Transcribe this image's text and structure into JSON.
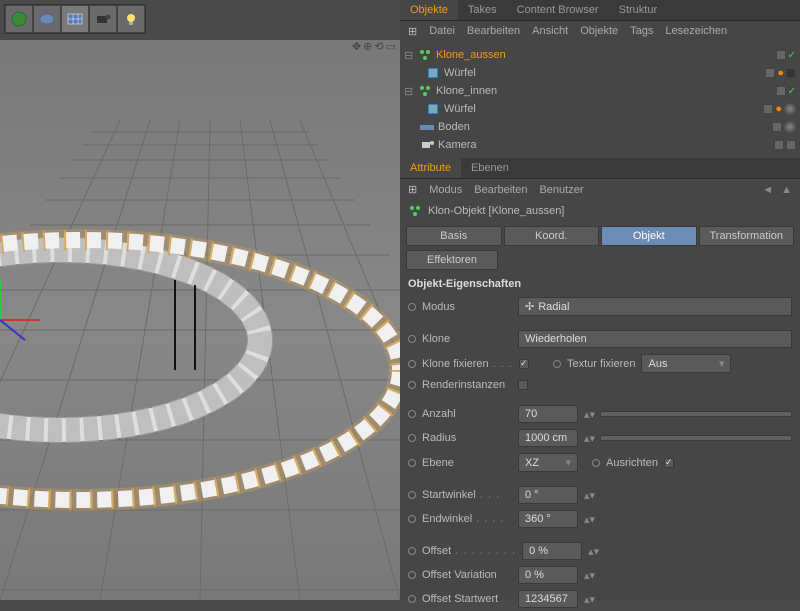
{
  "toolbar": {
    "icons": [
      "sphere",
      "blob",
      "grid",
      "camera",
      "light"
    ]
  },
  "viewport": {
    "axis_center": true
  },
  "tabs_top": {
    "objekte": "Objekte",
    "takes": "Takes",
    "content": "Content Browser",
    "struktur": "Struktur"
  },
  "obj_menu": {
    "datei": "Datei",
    "bearbeiten": "Bearbeiten",
    "ansicht": "Ansicht",
    "objekte": "Objekte",
    "tags": "Tags",
    "lesezeichen": "Lesezeichen"
  },
  "tree": {
    "items": [
      {
        "label": "Klone_aussen",
        "selected": true,
        "icon": "cloner"
      },
      {
        "label": "Würfel",
        "indent": 1,
        "icon": "cube"
      },
      {
        "label": "Klone_innen",
        "icon": "cloner"
      },
      {
        "label": "Würfel",
        "indent": 1,
        "icon": "cube"
      },
      {
        "label": "Boden",
        "icon": "floor"
      },
      {
        "label": "Kamera",
        "icon": "camera"
      }
    ]
  },
  "tabs_attr": {
    "attribute": "Attribute",
    "ebenen": "Ebenen"
  },
  "attr_menu": {
    "modus": "Modus",
    "bearbeiten": "Bearbeiten",
    "benutzer": "Benutzer"
  },
  "obj_title": "Klon-Objekt [Klone_aussen]",
  "attr_tabs": {
    "basis": "Basis",
    "koord": "Koord.",
    "objekt": "Objekt",
    "transformation": "Transformation",
    "effektoren": "Effektoren"
  },
  "section": "Objekt-Eigenschaften",
  "props": {
    "modus_label": "Modus",
    "modus_value": "Radial",
    "klone_label": "Klone",
    "klone_value": "Wiederholen",
    "klone_fix_label": "Klone fixieren",
    "textur_fix_label": "Textur fixieren",
    "textur_fix_value": "Aus",
    "renderinst_label": "Renderinstanzen",
    "anzahl_label": "Anzahl",
    "anzahl_value": "70",
    "radius_label": "Radius",
    "radius_value": "1000 cm",
    "ebene_label": "Ebene",
    "ebene_value": "XZ",
    "ausrichten_label": "Ausrichten",
    "startwinkel_label": "Startwinkel",
    "startwinkel_value": "0 °",
    "endwinkel_label": "Endwinkel",
    "endwinkel_value": "360 °",
    "offset_label": "Offset",
    "offset_value": "0 %",
    "offset_var_label": "Offset Variation",
    "offset_var_value": "0 %",
    "offset_start_label": "Offset Startwert",
    "offset_start_value": "1234567"
  }
}
